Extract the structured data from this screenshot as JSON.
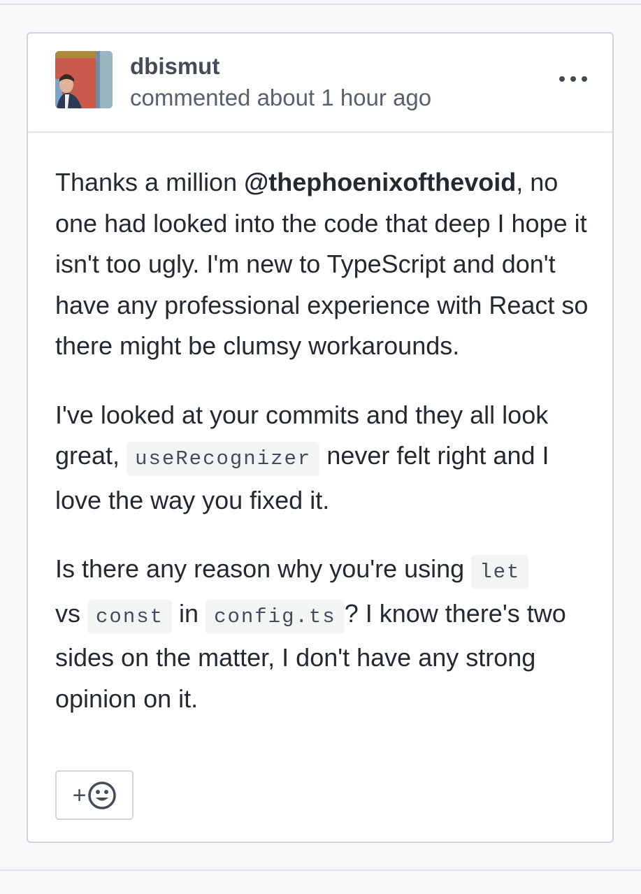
{
  "comment": {
    "author": "dbismut",
    "timestamp": "commented about 1 hour ago",
    "menu_icon": "kebab-horizontal-icon",
    "body": {
      "p1": {
        "before": "Thanks a million ",
        "mention": "@thephoenixofthevoid",
        "after": ", no one had looked into the code that deep I hope it isn't too ugly. I'm new to TypeScript and don't have any professional experience with React so there might be clumsy workarounds."
      },
      "p2": {
        "before": "I've looked at your commits and they all look great, ",
        "code": "useRecognizer",
        "after": " never felt right and I love the way you fixed it."
      },
      "p3": {
        "before": "Is there any reason why you're using ",
        "code1": "let",
        "mid1": " vs ",
        "code2": "const",
        "mid2": " in ",
        "code3": "config.ts",
        "after": "? I know there's two sides on the matter, I don't have any strong opinion on it."
      }
    },
    "reaction": {
      "plus_label": "+",
      "icon": "smiley-icon"
    }
  }
}
